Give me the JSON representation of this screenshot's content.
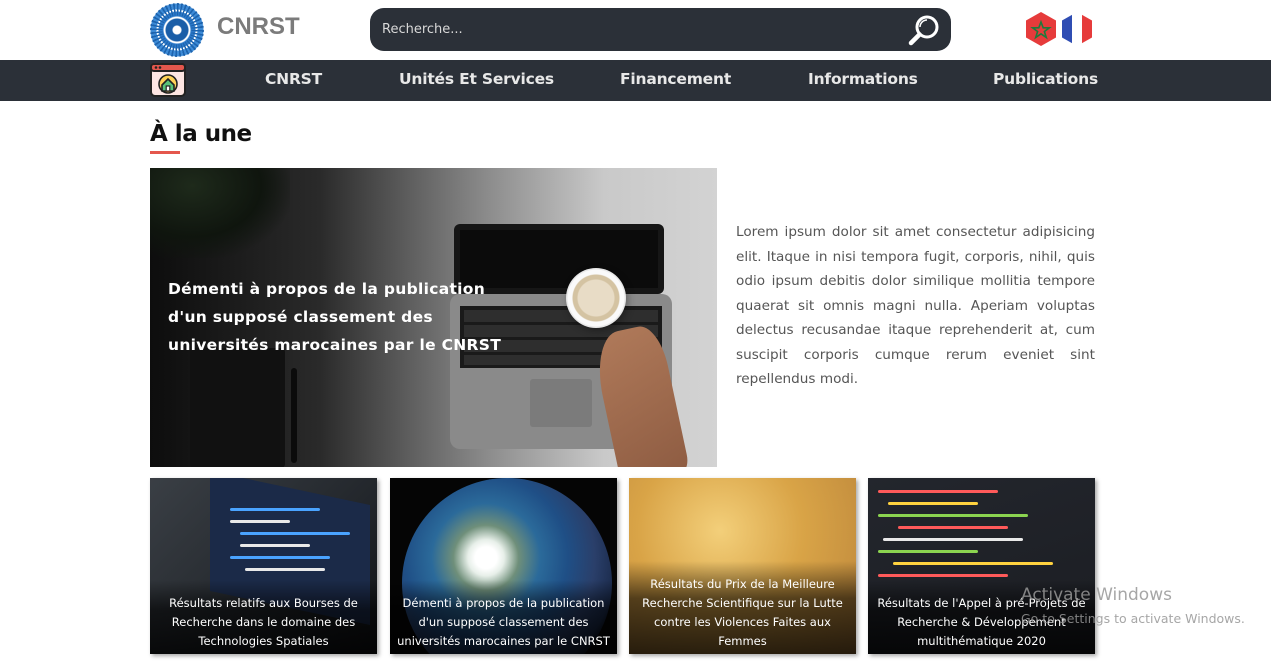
{
  "header": {
    "brand": "CNRST",
    "search": {
      "placeholder": "Recherche..."
    },
    "icons": {
      "logo": "cnrst-logo-icon",
      "search": "magnifier-icon",
      "flag_ma": "morocco-flag-icon",
      "flag_fr": "france-flag-icon"
    }
  },
  "nav": {
    "home_icon": "home-icon",
    "items": [
      {
        "label": "CNRST"
      },
      {
        "label": "Unités Et Services"
      },
      {
        "label": "Financement"
      },
      {
        "label": "Informations"
      },
      {
        "label": "Publications"
      }
    ]
  },
  "section": {
    "title": "À la une"
  },
  "featured": {
    "caption": "Démenti à propos de la publication d'un supposé classement des universités marocaines par le CNRST",
    "lead": "Lorem ipsum dolor sit amet consectetur adipisicing elit. Itaque in nisi tempora fugit, corporis, nihil, quis odio ipsum debitis dolor similique mollitia tempore quaerat sit omnis magni nulla. Aperiam voluptas delectus recusandae itaque reprehenderit at, cum suscipit corporis cumque rerum eveniet sint repellendus modi."
  },
  "cards": [
    {
      "caption": "Résultats relatifs aux Bourses de Recherche dans le domaine des Technologies Spatiales"
    },
    {
      "caption": "Démenti à propos de la publication d'un supposé classement des universités marocaines par le CNRST"
    },
    {
      "caption": "Résultats du Prix de la Meilleure Recherche Scientifique sur la Lutte contre les Violences Faites aux Femmes"
    },
    {
      "caption": "Résultats de l'Appel à pré-Projets de Recherche & Développement multithématique 2020"
    }
  ],
  "watermark": {
    "line1": "Activate Windows",
    "line2": "Go to Settings to activate Windows."
  },
  "colors": {
    "nav_bg": "#2b3038",
    "accent": "#e4574d"
  }
}
